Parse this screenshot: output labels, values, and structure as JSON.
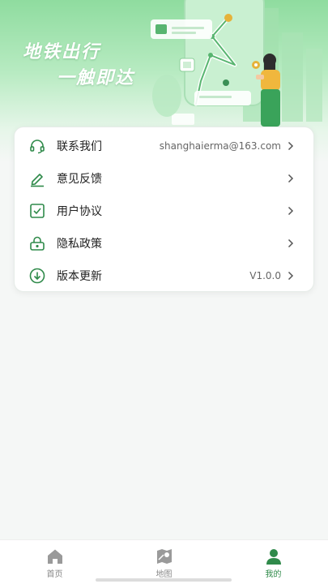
{
  "hero": {
    "slogan_line1": "地铁出行",
    "slogan_line2": "一触即达"
  },
  "menu": [
    {
      "label": "联系我们",
      "value": "shanghaierma@163.com",
      "icon": "headset-icon"
    },
    {
      "label": "意见反馈",
      "value": "",
      "icon": "pen-icon"
    },
    {
      "label": "用户协议",
      "value": "",
      "icon": "checkbox-icon"
    },
    {
      "label": "隐私政策",
      "value": "",
      "icon": "lock-icon"
    },
    {
      "label": "版本更新",
      "value": "V1.0.0",
      "icon": "download-icon"
    }
  ],
  "tabbar": [
    {
      "label": "首页",
      "icon": "home-icon",
      "active": false
    },
    {
      "label": "地图",
      "icon": "map-icon",
      "active": false
    },
    {
      "label": "我的",
      "icon": "profile-icon",
      "active": true
    }
  ],
  "colors": {
    "accent": "#2f8a4a",
    "hero_top": "#8fdc9f"
  }
}
